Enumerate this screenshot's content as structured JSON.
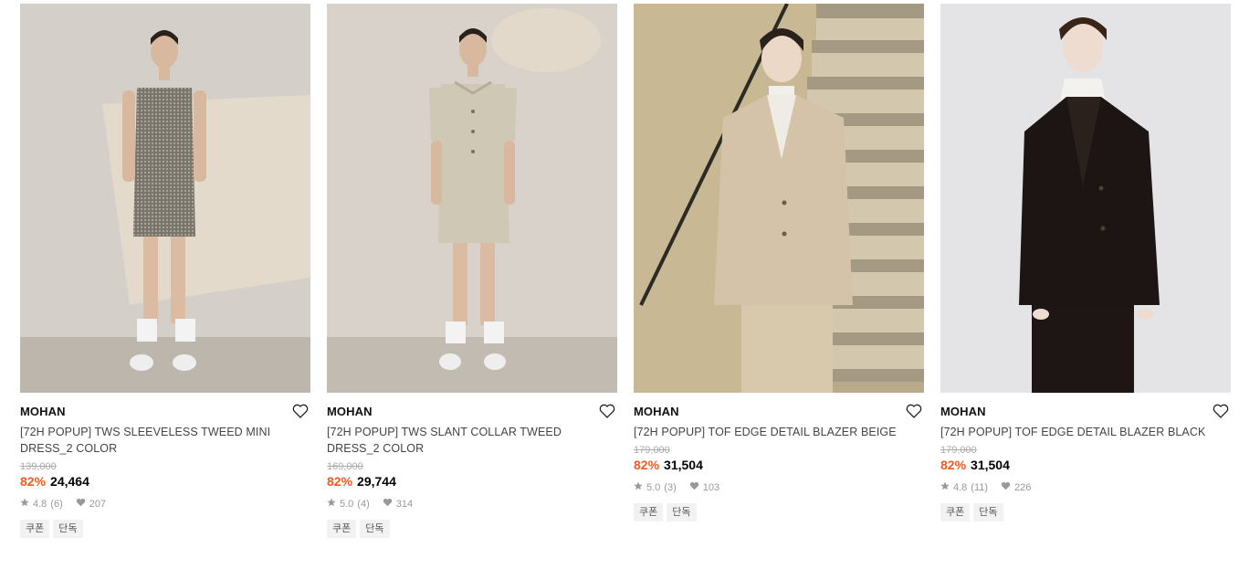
{
  "products": [
    {
      "brand": "MOHAN",
      "title": "[72H POPUP] TWS SLEEVELESS TWEED MINI DRESS_2 COLOR",
      "original_price": "139,000",
      "discount": "82%",
      "price": "24,464",
      "rating": "4.8",
      "reviews": "(6)",
      "likes": "207",
      "tags": [
        "쿠폰",
        "단독"
      ]
    },
    {
      "brand": "MOHAN",
      "title": "[72H POPUP] TWS SLANT COLLAR TWEED DRESS_2 COLOR",
      "original_price": "169,000",
      "discount": "82%",
      "price": "29,744",
      "rating": "5.0",
      "reviews": "(4)",
      "likes": "314",
      "tags": [
        "쿠폰",
        "단독"
      ]
    },
    {
      "brand": "MOHAN",
      "title": "[72H POPUP] TOF EDGE DETAIL BLAZER BEIGE",
      "original_price": "179,000",
      "discount": "82%",
      "price": "31,504",
      "rating": "5.0",
      "reviews": "(3)",
      "likes": "103",
      "tags": [
        "쿠폰",
        "단독"
      ]
    },
    {
      "brand": "MOHAN",
      "title": "[72H POPUP] TOF EDGE DETAIL BLAZER BLACK",
      "original_price": "179,000",
      "discount": "82%",
      "price": "31,504",
      "rating": "4.8",
      "reviews": "(11)",
      "likes": "226",
      "tags": [
        "쿠폰",
        "단독"
      ]
    }
  ],
  "icons": {
    "wishlist": "heart-outline-icon",
    "rating": "star-icon",
    "likes": "heart-filled-icon"
  },
  "colors": {
    "discount": "#f15a22",
    "original_price": "#aaaaaa",
    "meta": "#999999",
    "tag_bg": "#f2f2f2"
  }
}
